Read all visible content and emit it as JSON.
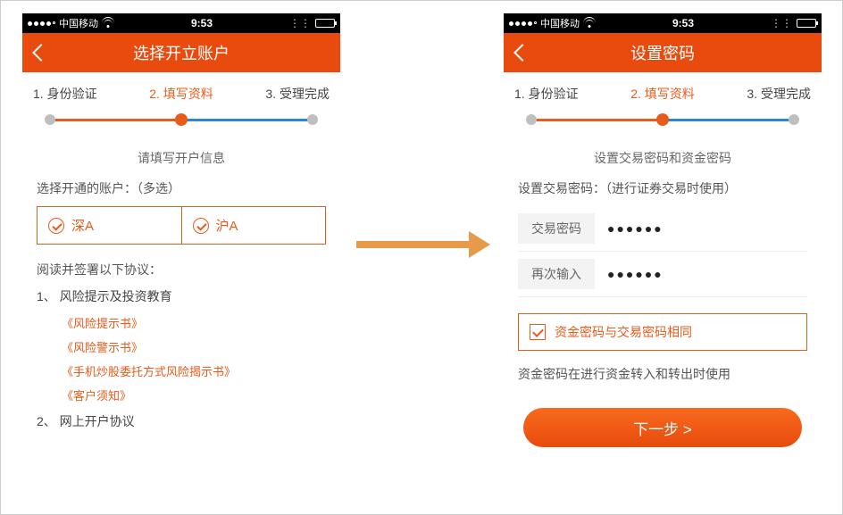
{
  "statusbar": {
    "carrier": "中国移动",
    "time": "9:53"
  },
  "left": {
    "title": "选择开立账户",
    "steps": [
      "1. 身份验证",
      "2. 填写资料",
      "3. 受理完成"
    ],
    "subtitle": "请填写开户信息",
    "accounts_label": "选择开通的账户：（多选）",
    "options": [
      "深A",
      "沪A"
    ],
    "agreements_label": "阅读并签署以下协议：",
    "section1_title": "1、 风险提示及投资教育",
    "links": [
      "《风险提示书》",
      "《风险警示书》",
      "《手机炒股委托方式风险揭示书》",
      "《客户须知》"
    ],
    "section2_title": "2、 网上开户协议"
  },
  "right": {
    "title": "设置密码",
    "steps": [
      "1. 身份验证",
      "2. 填写资料",
      "3. 受理完成"
    ],
    "subtitle": "设置交易密码和资金密码",
    "set_trade_label": "设置交易密码：（进行证券交易时使用）",
    "trade_label": "交易密码",
    "again_label": "再次输入",
    "password_mask": "●●●●●●",
    "same_box": "资金密码与交易密码相同",
    "note": "资金密码在进行资金转入和转出时使用",
    "next": "下一步 >"
  }
}
